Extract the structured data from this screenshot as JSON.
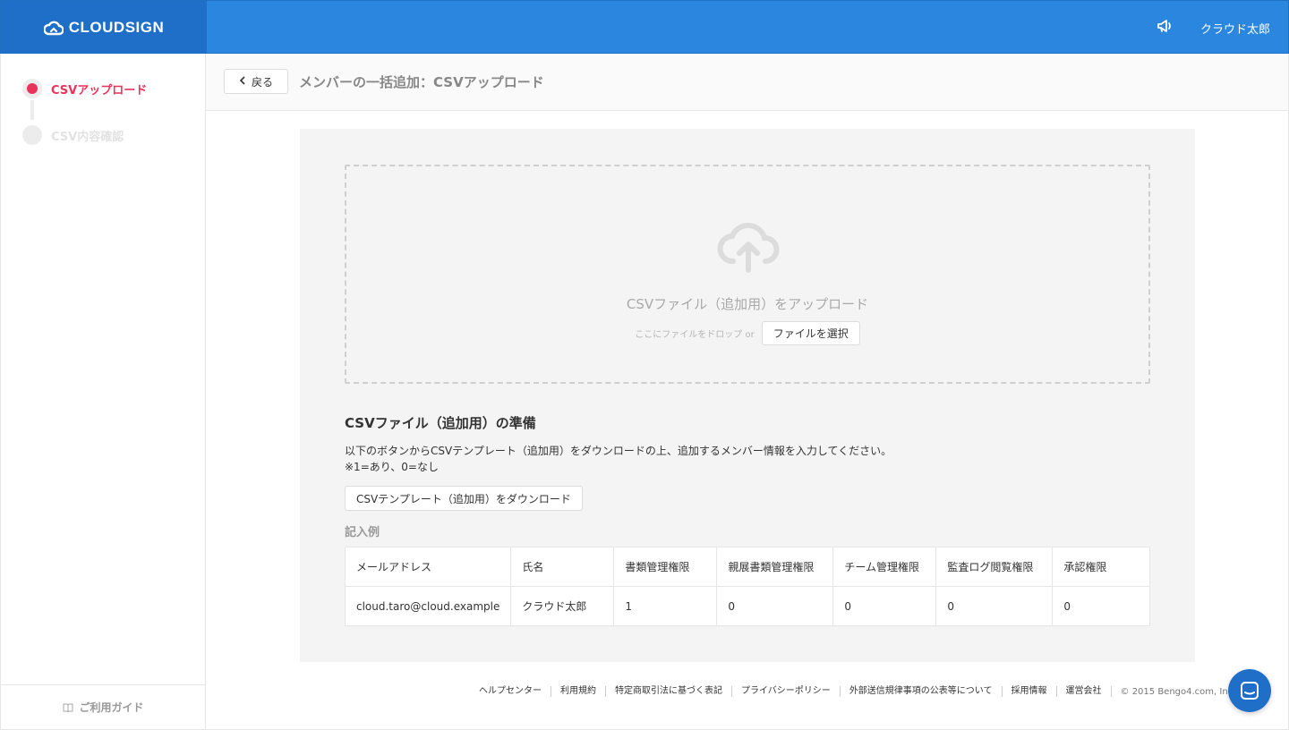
{
  "header": {
    "logo_text": "CLOUDSIGN",
    "user_name": "クラウド太郎",
    "color": "#2b86e0"
  },
  "sidebar": {
    "steps": [
      {
        "label": "CSVアップロード",
        "active": true
      },
      {
        "label": "CSV内容確認",
        "active": false
      }
    ],
    "guide_label": "ご利用ガイド"
  },
  "titlebar": {
    "back_label": "戻る",
    "title": "メンバーの一括追加：CSVアップロード"
  },
  "dropzone": {
    "title": "CSVファイル（追加用）をアップロード",
    "hint": "ここにファイルをドロップ or",
    "file_button": "ファイルを選択"
  },
  "prep": {
    "title": "CSVファイル（追加用）の準備",
    "desc_line1": "以下のボタンからCSVテンプレート（追加用）をダウンロードの上、追加するメンバー情報を入力してください。",
    "desc_line2": "※1=あり、0=なし",
    "download_button": "CSVテンプレート（追加用）をダウンロード",
    "example_label": "記入例"
  },
  "table": {
    "headers": [
      "メールアドレス",
      "氏名",
      "書類管理権限",
      "親展書類管理権限",
      "チーム管理権限",
      "監査ログ閲覧権限",
      "承認権限"
    ],
    "rows": [
      [
        "cloud.taro@cloud.example",
        "クラウド太郎",
        "1",
        "0",
        "0",
        "0",
        "0"
      ]
    ]
  },
  "footer": {
    "links": [
      "ヘルプセンター",
      "利用規約",
      "特定商取引法に基づく表記",
      "プライバシーポリシー",
      "外部送信規律事項の公表等について",
      "採用情報",
      "運営会社"
    ],
    "copyright": "© 2015 Bengo4.com, Inc."
  }
}
